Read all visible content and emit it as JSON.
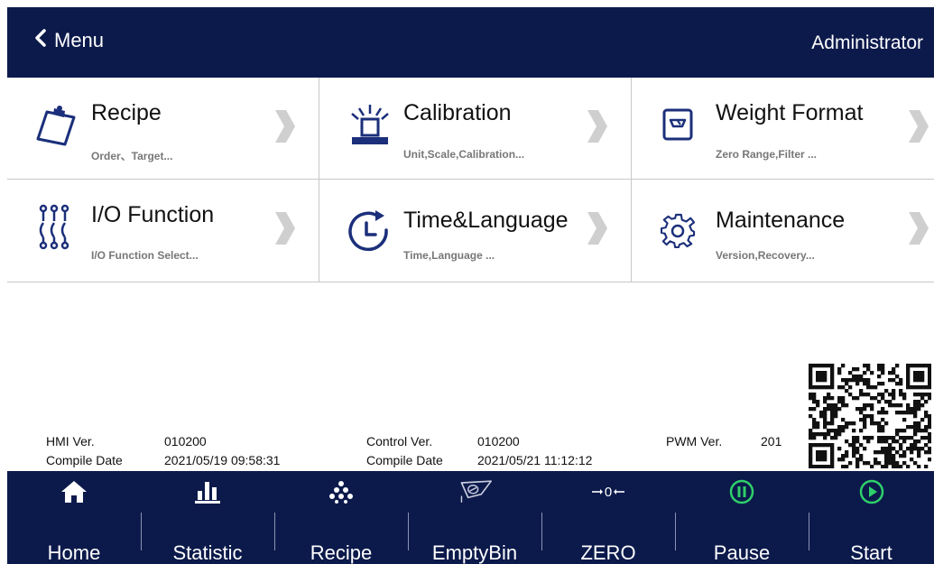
{
  "header": {
    "back_label": "Menu",
    "user_label": "Administrator",
    "background": "#0c1a4b"
  },
  "menu": {
    "tiles": [
      {
        "title": "Recipe",
        "subtitle": "Order、Target...",
        "icon": "clipboard-icon"
      },
      {
        "title": "Calibration",
        "subtitle": "Unit,Scale,Calibration...",
        "icon": "scale-weight-icon"
      },
      {
        "title": "Weight Format",
        "subtitle": "Zero Range,Filter ...",
        "icon": "scale-display-icon"
      },
      {
        "title": "I/O Function",
        "subtitle": "I/O Function Select...",
        "icon": "io-pins-icon"
      },
      {
        "title": "Time&Language",
        "subtitle": "Time,Language ...",
        "icon": "clock-icon"
      },
      {
        "title": "Maintenance",
        "subtitle": "Version,Recovery...",
        "icon": "gear-icon"
      }
    ]
  },
  "versions": {
    "hmi_label": "HMI Ver.",
    "hmi_value": "010200",
    "hmi_compile_label": "Compile Date",
    "hmi_compile_value": "2021/05/19 09:58:31",
    "control_label": "Control Ver.",
    "control_value": "010200",
    "control_compile_label": "Compile Date",
    "control_compile_value": "2021/05/21 11:12:12",
    "pwm_label": "PWM Ver.",
    "pwm_value": "201"
  },
  "bottom_nav": {
    "items": [
      {
        "label": "Home",
        "icon": "home-icon"
      },
      {
        "label": "Statistic",
        "icon": "bar-chart-icon"
      },
      {
        "label": "Recipe",
        "icon": "dots-pyramid-icon"
      },
      {
        "label": "EmptyBin",
        "icon": "empty-bin-icon"
      },
      {
        "label": "ZERO",
        "icon": "zero-arrows-icon"
      },
      {
        "label": "Pause",
        "icon": "pause-circle-icon"
      },
      {
        "label": "Start",
        "icon": "play-circle-icon"
      }
    ],
    "accent_green": "#2fcf6a"
  }
}
